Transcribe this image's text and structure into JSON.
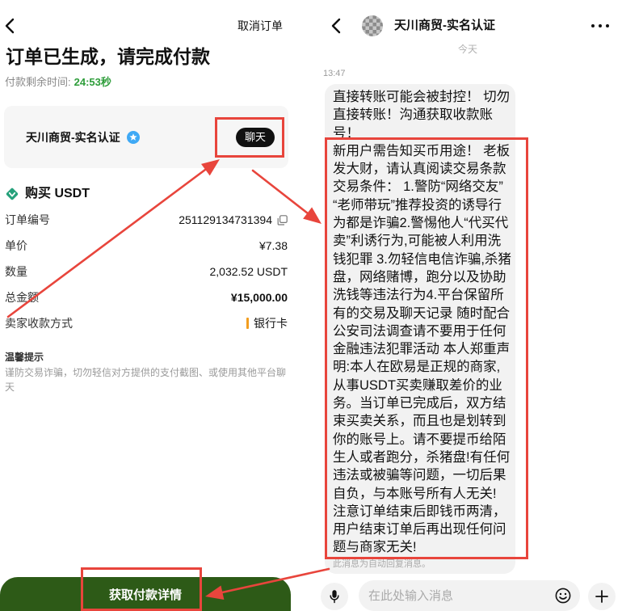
{
  "colors": {
    "countdown_green": "#2e9d3a",
    "button_green": "#2d5a17",
    "chat_button_bg": "#111111",
    "annotation_red": "#e8453c",
    "usdt_green": "#26a17b",
    "verified_blue": "#3fa9f5",
    "payment_method_orange": "#f29d1f",
    "bubble_bg": "#f2f2f2",
    "card_bg": "#f6f6f6"
  },
  "icons": {
    "back": "back-icon",
    "verified": "verified-badge-icon",
    "asset": "usdt-icon",
    "copy": "copy-icon",
    "more": "more-options-icon",
    "microphone": "microphone-icon",
    "emoji": "emoji-icon",
    "plus": "plus-icon"
  },
  "order_page": {
    "cancel_order": "取消订单",
    "title": "订单已生成，请完成付款",
    "countdown_label": "付款剩余时间:",
    "countdown_value": "24:53秒",
    "merchant": {
      "name": "天川商贸-实名认证",
      "chat_button": "聊天"
    },
    "asset_title": "购买 USDT",
    "rows": [
      {
        "label": "订单编号",
        "value": "251129134731394"
      },
      {
        "label": "单价",
        "value": "¥7.38"
      },
      {
        "label": "数量",
        "value": "2,032.52 USDT"
      },
      {
        "label": "总金额",
        "value": "¥15,000.00"
      },
      {
        "label": "卖家收款方式",
        "value": "银行卡"
      }
    ],
    "tips": {
      "title": "温馨提示",
      "text": "谨防交易诈骗，切勿轻信对方提供的支付截图、或使用其他平台聊天"
    },
    "primary_button": "获取付款详情"
  },
  "chat_page": {
    "contact_name": "天川商贸-实名认证",
    "date_divider": "今天",
    "message": {
      "time": "13:47",
      "lines": [
        "直接转账可能会被封控！ 切勿",
        "直接转账！沟通获取收款账",
        "号！",
        "新用户需告知买币用途！ 老板",
        "发大财，请认真阅读交易条款",
        "交易条件： 1.警防“网络交友”",
        "“老师带玩”推荐投资的诱导行",
        "为都是诈骗2.警惕他人“代买代",
        "卖”利诱行为,可能被人利用洗",
        "钱犯罪 3.勿轻信电信诈骗,杀猪",
        "盘，网络赌博，跑分以及协助",
        "洗钱等违法行为4.平台保留所",
        "有的交易及聊天记录 随时配合",
        "公安司法调查请不要用于任何",
        "金融违法犯罪活动 本人郑重声",
        "明:本人在欧易是正规的商家,",
        "从事USDT买卖赚取差价的业",
        "务。当订单已完成后，双方结",
        "束买卖关系，而且也是划转到",
        "你的账号上。请不要提币给陌",
        "生人或者跑分，杀猪盘!有任何",
        "违法或被骗等问题，一切后果",
        "自负，与本账号所有人无关!",
        "注意订单结束后即钱币两清，",
        "用户结束订单后再出现任何问",
        "题与商家无关!"
      ],
      "auto_reply_note": "此消息为自动回复消息。"
    },
    "input_placeholder": "在此处输入消息"
  }
}
